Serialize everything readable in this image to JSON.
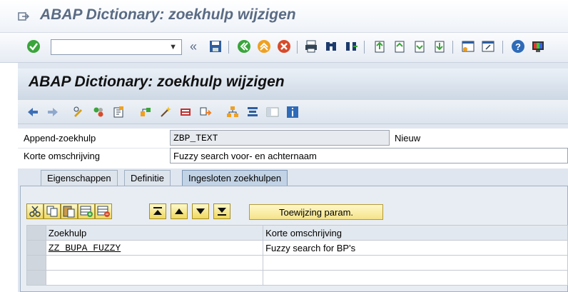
{
  "window_title": "ABAP Dictionary: zoekhulp wijzigen",
  "screen_title": "ABAP Dictionary: zoekhulp wijzigen",
  "command_field": {
    "value": ""
  },
  "form": {
    "append_label": "Append-zoekhulp",
    "append_value": "ZBP_TEXT",
    "append_status": "Nieuw",
    "desc_label": "Korte omschrijving",
    "desc_value": "Fuzzy search voor- en achternaam"
  },
  "tabs": [
    {
      "label": "Eigenschappen"
    },
    {
      "label": "Definitie"
    },
    {
      "label": "Ingesloten zoekhulpen",
      "active": true
    }
  ],
  "assign_button": "Toewijzing param.",
  "table": {
    "headers": [
      "Zoekhulp",
      "Korte omschrijving"
    ],
    "rows": [
      [
        "ZZ_BUPA_FUZZY",
        "Fuzzy search for BP's"
      ],
      [
        "",
        ""
      ],
      [
        "",
        ""
      ]
    ]
  },
  "colors": {
    "title": "#5a6b84",
    "accent": "#f0d85a"
  }
}
